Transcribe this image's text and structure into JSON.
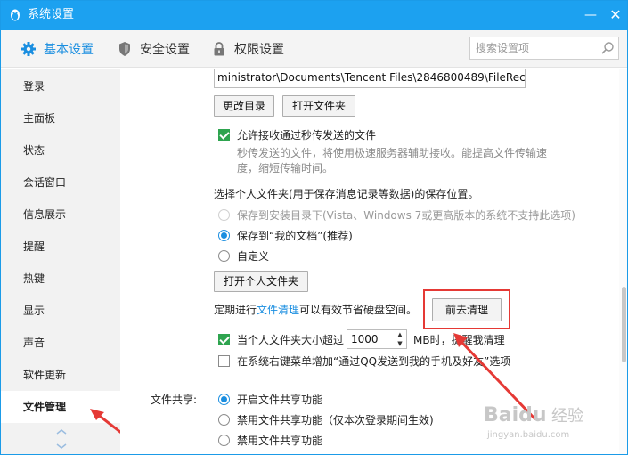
{
  "window": {
    "title": "系统设置",
    "minimize": "—",
    "close": "✕"
  },
  "tabs": [
    {
      "label": "基本设置",
      "icon": "gear-icon",
      "active": true
    },
    {
      "label": "安全设置",
      "icon": "shield-icon"
    },
    {
      "label": "权限设置",
      "icon": "lock-icon"
    }
  ],
  "search": {
    "placeholder": "搜索设置项",
    "icon": "search-icon"
  },
  "sidebar": {
    "items": [
      {
        "label": "登录"
      },
      {
        "label": "主面板"
      },
      {
        "label": "状态"
      },
      {
        "label": "会话窗口"
      },
      {
        "label": "信息展示"
      },
      {
        "label": "提醒"
      },
      {
        "label": "热键"
      },
      {
        "label": "显示"
      },
      {
        "label": "声音"
      },
      {
        "label": "软件更新"
      },
      {
        "label": "文件管理",
        "active": true
      }
    ]
  },
  "main": {
    "path_value": "ministrator\\Documents\\Tencent Files\\2846800489\\FileRecv\\",
    "change_dir_button": "更改目录",
    "open_folder_button": "打开文件夹",
    "allow_fast_transfer": {
      "label": "允许接收通过秒传发送的文件",
      "checked": true,
      "desc_line1": "秒传发送的文件，将使用极速服务器辅助接收。能提高文件传输速",
      "desc_line2": "度，缩短传输时间。"
    },
    "personal_folder_heading": "选择个人文件夹(用于保存消息记录等数据)的保存位置。",
    "save_options": [
      {
        "label": "保存到安装目录下(Vista、Windows 7或更高版本的系统不支持此选项)",
        "disabled": true
      },
      {
        "label": "保存到“我的文档”(推荐)",
        "checked": true
      },
      {
        "label": "自定义"
      }
    ],
    "open_personal_folder_button": "打开个人文件夹",
    "cleanup_prefix": "定期进行",
    "cleanup_link": "文件清理",
    "cleanup_suffix": "可以有效节省硬盘空间。",
    "go_cleanup_button": "前去清理",
    "size_alert": {
      "label_before": "当个人文件夹大小超过",
      "value": "1000",
      "label_after": "MB时，提醒我清理",
      "checked": true
    },
    "context_menu": {
      "label": "在系统右键菜单增加“通过QQ发送到我的手机及好友”选项",
      "checked": false
    },
    "file_sharing": {
      "label": "文件共享:",
      "options": [
        {
          "label": "开启文件共享功能",
          "checked": true
        },
        {
          "label": "禁用文件共享功能（仅本次登录期间生效)"
        },
        {
          "label": "禁用文件共享功能"
        }
      ]
    }
  },
  "watermark": {
    "text": "Baidu 经验",
    "subtext": "jingyan.baidu.com"
  },
  "colors": {
    "titlebar": "#1ca1f0",
    "accent": "#1a8ee0",
    "checkbox": "#2ea44f",
    "annotation": "#e53935"
  }
}
